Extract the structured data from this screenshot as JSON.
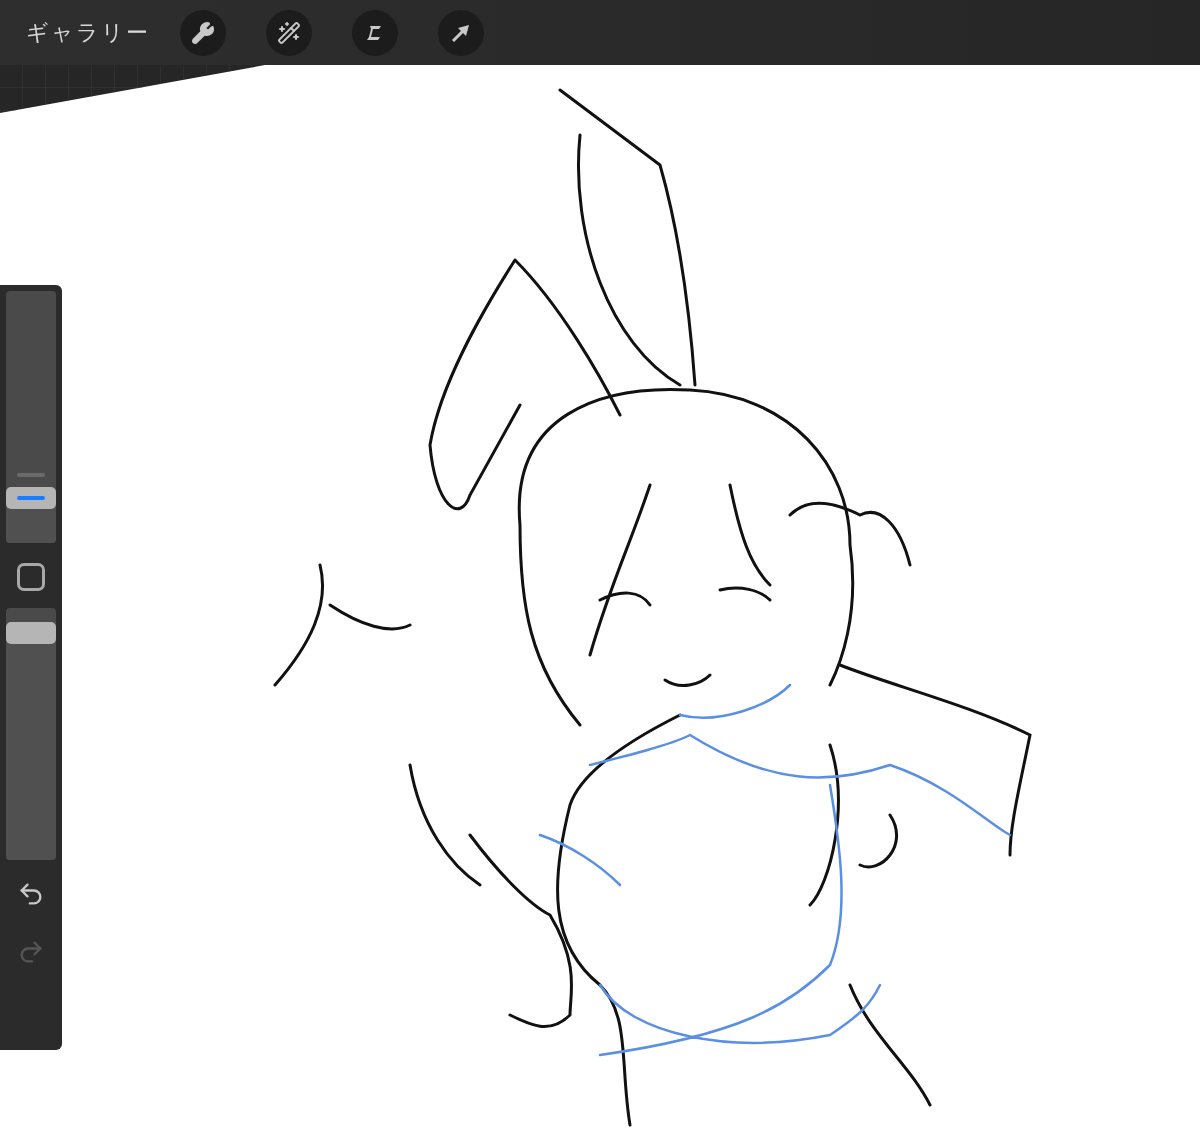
{
  "top_bar": {
    "gallery_label": "ギャラリー"
  },
  "sidebar": {
    "brush_size": {
      "level": 0.15
    },
    "opacity": {
      "level": 0.94
    },
    "undo": {
      "disabled": false
    },
    "redo": {
      "disabled": true
    }
  }
}
